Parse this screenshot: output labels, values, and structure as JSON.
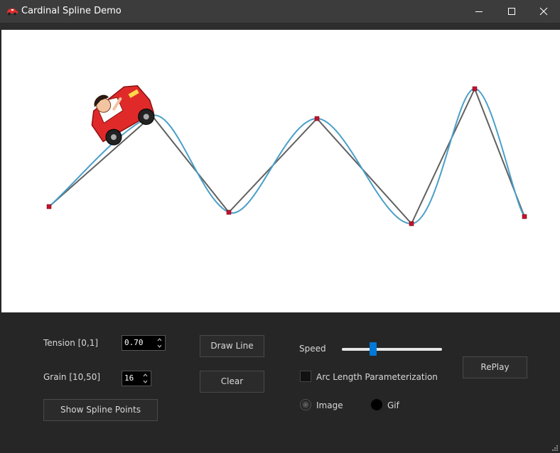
{
  "window": {
    "title": "Cardinal Spline Demo",
    "controls": [
      "minimize",
      "maximize",
      "close"
    ]
  },
  "canvas": {
    "icons": {
      "car": "cartoon-car-with-driver-icon"
    },
    "colors": {
      "spline": "#4a9fc8",
      "polyline": "#606060",
      "control_point": "#c8102e"
    }
  },
  "controls": {
    "tension": {
      "label": "Tension [0,1]",
      "value": "0.70"
    },
    "grain": {
      "label": "Grain [10,50]",
      "value": "16"
    },
    "show_points_label": "Show Spline Points",
    "draw_line_label": "Draw Line",
    "clear_label": "Clear",
    "speed": {
      "label": "Speed",
      "level": 0.3
    },
    "arc_length": {
      "label": "Arc Length Parameterization",
      "checked": false
    },
    "mode": {
      "options": [
        "Image",
        "Gif"
      ],
      "selected": "Image"
    },
    "replay_label": "RePlay",
    "accent": "#0078d7"
  }
}
